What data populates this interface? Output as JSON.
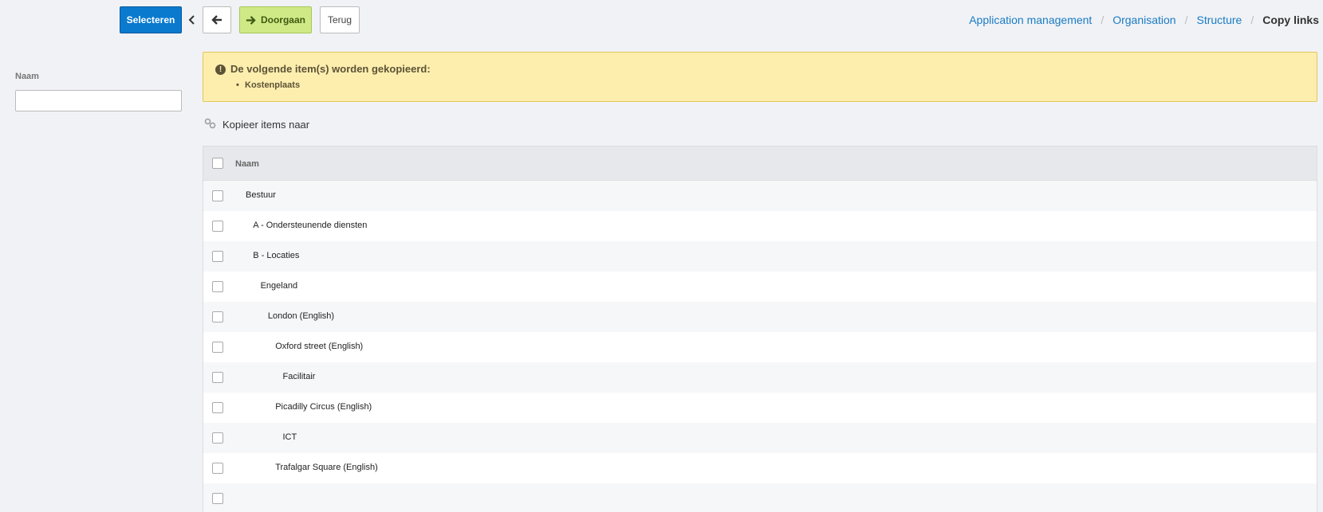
{
  "toolbar": {
    "select_label": "Selecteren",
    "continue_label": "Doorgaan",
    "back_label": "Terug"
  },
  "breadcrumb": {
    "items": [
      "Application management",
      "Organisation",
      "Structure"
    ],
    "current": "Copy links"
  },
  "filter": {
    "label": "Naam",
    "value": ""
  },
  "warning": {
    "title": "De volgende item(s) worden gekopieerd:",
    "items": [
      "Kostenplaats"
    ]
  },
  "section": {
    "heading": "Kopieer items naar"
  },
  "table": {
    "header": "Naam",
    "rows": [
      {
        "label": "Bestuur",
        "level": 0
      },
      {
        "label": "A - Ondersteunende diensten",
        "level": 1
      },
      {
        "label": "B - Locaties",
        "level": 1
      },
      {
        "label": "Engeland",
        "level": 2
      },
      {
        "label": "London (English)",
        "level": 3
      },
      {
        "label": "Oxford street (English)",
        "level": 4
      },
      {
        "label": "Facilitair",
        "level": 5
      },
      {
        "label": "Picadilly Circus (English)",
        "level": 4
      },
      {
        "label": "ICT",
        "level": 5
      },
      {
        "label": "Trafalgar Square (English)",
        "level": 4
      },
      {
        "label": "",
        "level": 5
      }
    ]
  }
}
